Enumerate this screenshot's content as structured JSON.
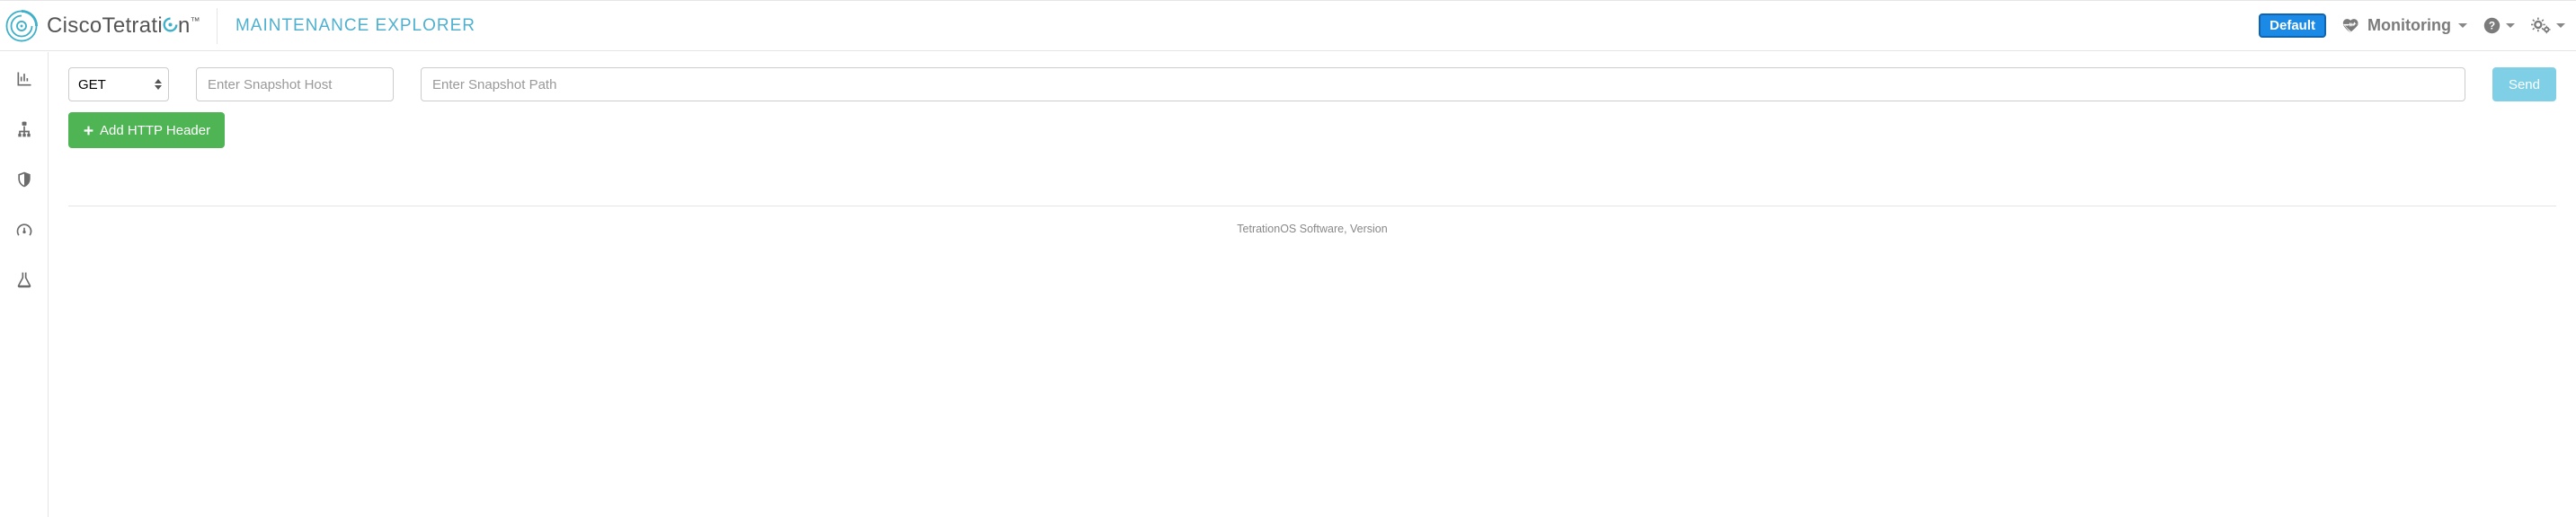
{
  "header": {
    "brand_a": "Cisco",
    "brand_b": "Tetrati",
    "brand_c": "n",
    "page_title": "MAINTENANCE EXPLORER",
    "badge": "Default",
    "monitoring_label": "Monitoring"
  },
  "form": {
    "method_selected": "GET",
    "host_placeholder": "Enter Snapshot Host",
    "path_placeholder": "Enter Snapshot Path",
    "send_label": "Send",
    "add_header_label": "Add HTTP Header"
  },
  "footer": {
    "text": "TetrationOS Software, Version"
  }
}
